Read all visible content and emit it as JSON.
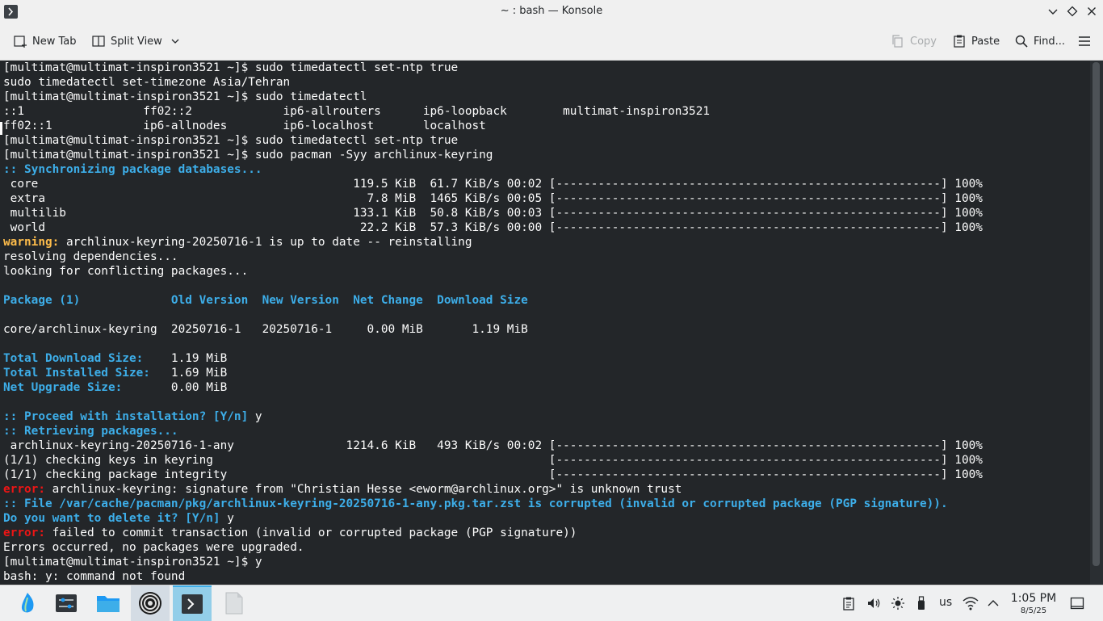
{
  "window": {
    "title": "~ : bash — Konsole"
  },
  "toolbar": {
    "new_tab": "New Tab",
    "split_view": "Split View",
    "copy": "Copy",
    "paste": "Paste",
    "find": "Find..."
  },
  "terminal": {
    "lines": [
      [
        {
          "t": "[multimat@multimat-inspiron3521 ~]$ sudo timedatectl set-ntp true"
        }
      ],
      [
        {
          "t": "sudo timedatectl set-timezone Asia/Tehran"
        }
      ],
      [
        {
          "t": "[multimat@multimat-inspiron3521 ~]$ sudo timedatectl"
        }
      ],
      [
        {
          "t": "::1                 ff02::2             ip6-allrouters      ip6-loopback        multimat-inspiron3521"
        }
      ],
      [
        {
          "t": "ff02::1             ip6-allnodes        ip6-localhost       localhost"
        }
      ],
      [
        {
          "t": "[multimat@multimat-inspiron3521 ~]$ sudo timedatectl set-ntp true"
        }
      ],
      [
        {
          "t": "[multimat@multimat-inspiron3521 ~]$ sudo pacman -Syy archlinux-keyring"
        }
      ],
      [
        {
          "t": ":: Synchronizing package databases...",
          "c": "b"
        }
      ],
      [
        {
          "t": " core                                             119.5 KiB  61.7 KiB/s 00:02 [-------------------------------------------------------] 100%"
        }
      ],
      [
        {
          "t": " extra                                              7.8 MiB  1465 KiB/s 00:05 [-------------------------------------------------------] 100%"
        }
      ],
      [
        {
          "t": " multilib                                         133.1 KiB  50.8 KiB/s 00:03 [-------------------------------------------------------] 100%"
        }
      ],
      [
        {
          "t": " world                                             22.2 KiB  57.3 KiB/s 00:00 [-------------------------------------------------------] 100%"
        }
      ],
      [
        {
          "t": "warning:",
          "c": "y"
        },
        {
          "t": " archlinux-keyring-20250716-1 is up to date -- reinstalling"
        }
      ],
      [
        {
          "t": "resolving dependencies..."
        }
      ],
      [
        {
          "t": "looking for conflicting packages..."
        }
      ],
      [
        {
          "t": ""
        }
      ],
      [
        {
          "t": "Package (1)             Old Version  New Version  Net Change  Download Size",
          "c": "b"
        }
      ],
      [
        {
          "t": ""
        }
      ],
      [
        {
          "t": "core/archlinux-keyring  20250716-1   20250716-1     0.00 MiB       1.19 MiB"
        }
      ],
      [
        {
          "t": ""
        }
      ],
      [
        {
          "t": "Total Download Size:  ",
          "c": "b"
        },
        {
          "t": "  1.19 MiB"
        }
      ],
      [
        {
          "t": "Total Installed Size: ",
          "c": "b"
        },
        {
          "t": "  1.69 MiB"
        }
      ],
      [
        {
          "t": "Net Upgrade Size:     ",
          "c": "b"
        },
        {
          "t": "  0.00 MiB"
        }
      ],
      [
        {
          "t": ""
        }
      ],
      [
        {
          "t": ":: Proceed with installation? [Y/n]",
          "c": "b"
        },
        {
          "t": " y"
        }
      ],
      [
        {
          "t": ":: Retrieving packages...",
          "c": "b"
        }
      ],
      [
        {
          "t": " archlinux-keyring-20250716-1-any                1214.6 KiB   493 KiB/s 00:02 [-------------------------------------------------------] 100%"
        }
      ],
      [
        {
          "t": "(1/1) checking keys in keyring                                                [-------------------------------------------------------] 100%"
        }
      ],
      [
        {
          "t": "(1/1) checking package integrity                                              [-------------------------------------------------------] 100%"
        }
      ],
      [
        {
          "t": "error:",
          "c": "r"
        },
        {
          "t": " archlinux-keyring: signature from \"Christian Hesse <eworm@archlinux.org>\" is unknown trust"
        }
      ],
      [
        {
          "t": ":: File /var/cache/pacman/pkg/archlinux-keyring-20250716-1-any.pkg.tar.zst is corrupted (invalid or corrupted package (PGP signature)).",
          "c": "b"
        }
      ],
      [
        {
          "t": "Do you want to delete it? [Y/n]",
          "c": "b"
        },
        {
          "t": " y"
        }
      ],
      [
        {
          "t": "error:",
          "c": "r"
        },
        {
          "t": " failed to commit transaction (invalid or corrupted package (PGP signature))"
        }
      ],
      [
        {
          "t": "Errors occurred, no packages were upgraded."
        }
      ],
      [
        {
          "t": "[multimat@multimat-inspiron3521 ~]$ y"
        }
      ],
      [
        {
          "t": "bash: y: command not found"
        }
      ]
    ]
  },
  "tray": {
    "keyboard_layout": "us"
  },
  "clock": {
    "time": "1:05 PM",
    "date": "8/5/25"
  },
  "colors": {
    "terminal_bg": "#232629",
    "accent": "#3daee9",
    "warning": "#fdbc4b",
    "error": "#ed1515"
  }
}
